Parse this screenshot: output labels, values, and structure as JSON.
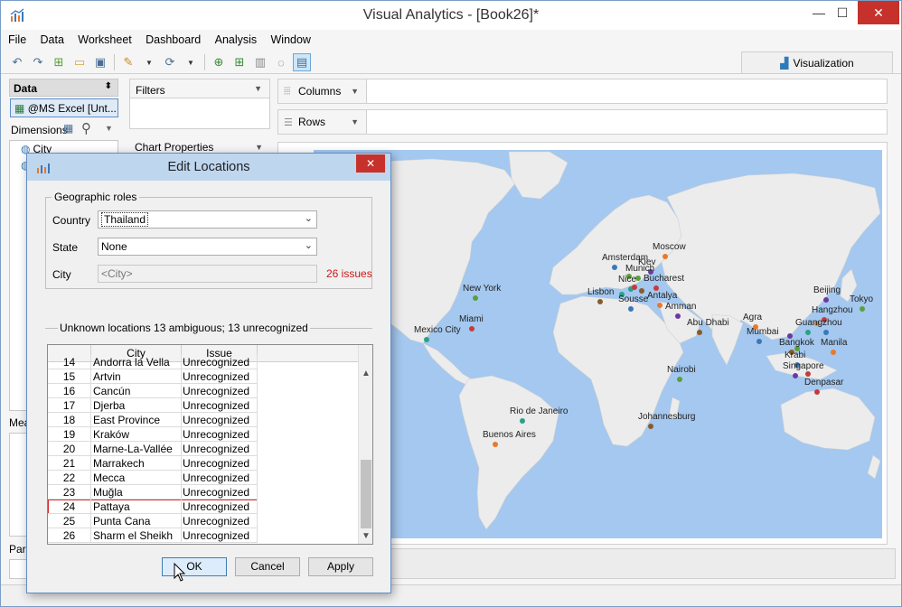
{
  "window": {
    "title": "Visual Analytics - [Book26]*",
    "minimize": "—",
    "maximize": "☐",
    "close": "✕"
  },
  "menu": [
    "File",
    "Data",
    "Worksheet",
    "Dashboard",
    "Analysis",
    "Window"
  ],
  "visualization_tab": "Visualization",
  "data_panel": {
    "header": "Data",
    "source": "@MS Excel [Unt...",
    "dimensions_label": "Dimensions",
    "dimensions": [
      "City",
      ""
    ],
    "measures_label": "Mea",
    "parameters_label": "Par"
  },
  "filters_label": "Filters",
  "chart_properties_label": "Chart Properties",
  "columns_label": "Columns",
  "rows_label": "Rows",
  "map": {
    "labels": [
      {
        "text": "Moscow"
      },
      {
        "text": "Amsterdam"
      },
      {
        "text": "Kiev"
      },
      {
        "text": "Munich"
      },
      {
        "text": "Bucharest"
      },
      {
        "text": "Nice"
      },
      {
        "text": "Lisbon"
      },
      {
        "text": "Antalya"
      },
      {
        "text": "Sousse"
      },
      {
        "text": "Amman"
      },
      {
        "text": "New York"
      },
      {
        "text": "Miami"
      },
      {
        "text": "Mexico City"
      },
      {
        "text": "Abu Dhabi"
      },
      {
        "text": "Agra"
      },
      {
        "text": "Mumbai"
      },
      {
        "text": "Beijing"
      },
      {
        "text": "Tokyo"
      },
      {
        "text": "Hangzhou"
      },
      {
        "text": "Guangzhou"
      },
      {
        "text": "Bangkok"
      },
      {
        "text": "Manila"
      },
      {
        "text": "Krabi"
      },
      {
        "text": "Singapore"
      },
      {
        "text": "Nairobi"
      },
      {
        "text": "Denpasar"
      },
      {
        "text": "Rio de Janeiro"
      },
      {
        "text": "Johannesburg"
      },
      {
        "text": "Buenos Aires"
      }
    ]
  },
  "dialog": {
    "title": "Edit Locations",
    "close": "✕",
    "group_title": "Geographic roles",
    "country_label": "Country",
    "country_value": "Thailand",
    "state_label": "State",
    "state_value": "None",
    "city_label": "City",
    "city_value": "<City>",
    "issues": "26 issues",
    "unknown_summary": "Unknown locations  13 ambiguous; 13 unrecognized",
    "table": {
      "headers": [
        "",
        "City",
        "Issue"
      ],
      "rows": [
        [
          "14",
          "Andorra la Vella",
          "Unrecognized"
        ],
        [
          "15",
          "Artvin",
          "Unrecognized"
        ],
        [
          "16",
          "Cancún",
          "Unrecognized"
        ],
        [
          "17",
          "Djerba",
          "Unrecognized"
        ],
        [
          "18",
          "East Province",
          "Unrecognized"
        ],
        [
          "19",
          "Kraków",
          "Unrecognized"
        ],
        [
          "20",
          "Marne-La-Vallée",
          "Unrecognized"
        ],
        [
          "21",
          "Marrakech",
          "Unrecognized"
        ],
        [
          "22",
          "Mecca",
          "Unrecognized"
        ],
        [
          "23",
          "Muğla",
          "Unrecognized"
        ],
        [
          "24",
          "Pattaya",
          "Unrecognized"
        ],
        [
          "25",
          "Punta Cana",
          "Unrecognized"
        ],
        [
          "26",
          "Sharm el Sheikh",
          "Unrecognized"
        ]
      ],
      "selected_row": "24"
    },
    "ok_label": "OK",
    "cancel_label": "Cancel",
    "apply_label": "Apply"
  },
  "colors": {
    "ocean": "#a4c8ef",
    "land": "#ececec",
    "accent": "#5f8ec6",
    "issue_red": "#c81818"
  }
}
